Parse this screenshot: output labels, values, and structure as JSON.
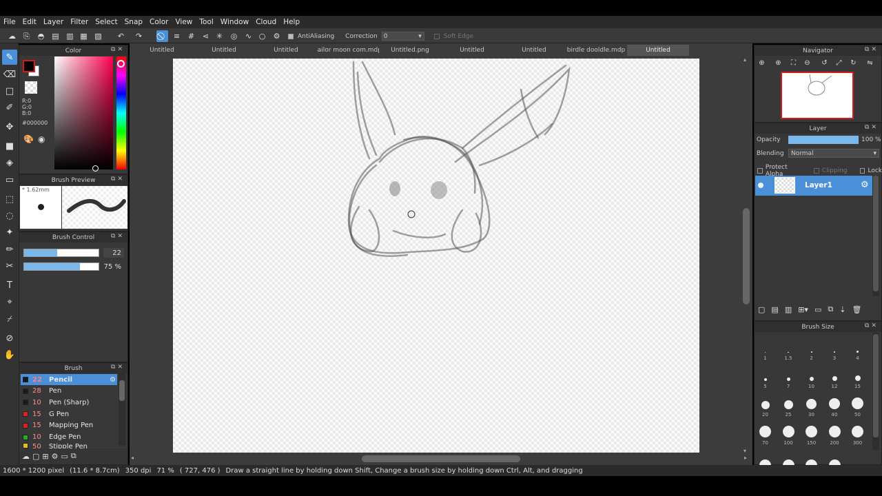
{
  "menu": [
    "File",
    "Edit",
    "Layer",
    "Filter",
    "Select",
    "Snap",
    "Color",
    "View",
    "Tool",
    "Window",
    "Cloud",
    "Help"
  ],
  "toolbar": {
    "antialiasing_label": "AntiAliasing",
    "correction_label": "Correction",
    "correction_value": "0",
    "soft_edge_label": "Soft Edge"
  },
  "color_panel": {
    "title": "Color",
    "r": "R:0",
    "g": "G:0",
    "b": "B:0",
    "hex": "#000000",
    "fg_color": "#000000",
    "accent": "#d41c1c"
  },
  "brush_preview": {
    "title": "Brush Preview",
    "size": "* 1.62mm"
  },
  "brush_control": {
    "title": "Brush Control",
    "size_value": "22",
    "size_fraction": 0.44,
    "opacity_value": "75 %",
    "opacity_fraction": 0.75
  },
  "brush_panel": {
    "title": "Brush",
    "items": [
      {
        "size": "22",
        "name": "Pencil",
        "color": "#1a1a1a",
        "active": true
      },
      {
        "size": "28",
        "name": "Pen",
        "color": "#1a1a1a"
      },
      {
        "size": "10",
        "name": "Pen (Sharp)",
        "color": "#1a1a1a"
      },
      {
        "size": "15",
        "name": "G Pen",
        "color": "#e02020"
      },
      {
        "size": "15",
        "name": "Mapping Pen",
        "color": "#e02020"
      },
      {
        "size": "10",
        "name": "Edge Pen",
        "color": "#20b020"
      },
      {
        "size": "50",
        "name": "Stipple Pen",
        "color": "#e0c020"
      }
    ]
  },
  "tabs": [
    "Untitled",
    "Untitled",
    "Untitled",
    "sailor moon com.mdp",
    "Untitled.png",
    "Untitled",
    "Untitled",
    "birdle dooldle.mdp",
    "Untitled"
  ],
  "navigator": {
    "title": "Navigator"
  },
  "layer_panel": {
    "title": "Layer",
    "opacity_label": "Opacity",
    "opacity_value": "100 %",
    "blending_label": "Blending",
    "blending_value": "Normal",
    "protect_alpha": "Protect Alpha",
    "clipping": "Clipping",
    "lock": "Lock",
    "layer_name": "Layer1"
  },
  "brush_size_panel": {
    "title": "Brush Size",
    "sizes": [
      "1",
      "1.5",
      "2",
      "3",
      "4",
      "5",
      "7",
      "10",
      "12",
      "15",
      "20",
      "25",
      "30",
      "40",
      "50",
      "70",
      "100",
      "150",
      "200",
      "300",
      "",
      "",
      "",
      ""
    ]
  },
  "status": {
    "dimensions": "1600 * 1200 pixel",
    "physical": "(11.6 * 8.7cm)",
    "dpi": "350 dpi",
    "zoom": "71 %",
    "coords": "( 727, 476 )",
    "hint": "Draw a straight line by holding down Shift, Change a brush size by holding down Ctrl, Alt, and dragging"
  }
}
